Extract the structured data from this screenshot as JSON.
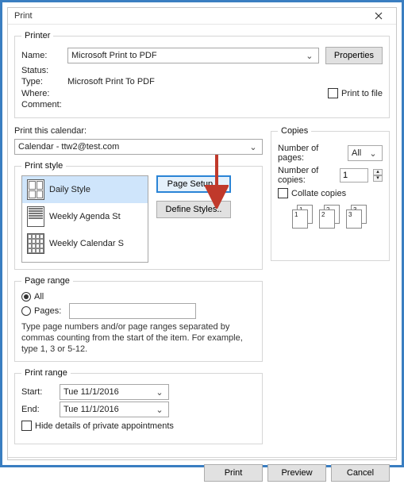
{
  "window": {
    "title": "Print"
  },
  "printer": {
    "group_label": "Printer",
    "name_label": "Name:",
    "name_value": "Microsoft Print to PDF",
    "properties_btn": "Properties",
    "status_label": "Status:",
    "status_value": "",
    "type_label": "Type:",
    "type_value": "Microsoft Print To PDF",
    "where_label": "Where:",
    "where_value": "",
    "comment_label": "Comment:",
    "comment_value": "",
    "print_to_file_label": "Print to file"
  },
  "calendar": {
    "label": "Print this calendar:",
    "value": "Calendar - ttw2@test.com"
  },
  "style": {
    "group_label": "Print style",
    "items": [
      {
        "label": "Daily Style",
        "selected": true
      },
      {
        "label": "Weekly Agenda St",
        "selected": false
      },
      {
        "label": "Weekly Calendar S",
        "selected": false
      }
    ],
    "page_setup_btn": "Page Setup...",
    "define_styles_btn": "Define Styles.."
  },
  "page_range": {
    "group_label": "Page range",
    "all_label": "All",
    "pages_label": "Pages:",
    "pages_value": "",
    "hint": "Type page numbers and/or page ranges separated by commas counting from the start of the item.  For example, type 1, 3 or 5-12."
  },
  "print_range": {
    "group_label": "Print range",
    "start_label": "Start:",
    "end_label": "End:",
    "start_value": "Tue 11/1/2016",
    "end_value": "Tue 11/1/2016",
    "hide_details_label": "Hide details of private appointments"
  },
  "copies": {
    "group_label": "Copies",
    "num_pages_label": "Number of pages:",
    "num_pages_value": "All",
    "num_copies_label": "Number of copies:",
    "num_copies_value": "1",
    "collate_label": "Collate copies",
    "graphic_nums": [
      "1",
      "1",
      "2",
      "2",
      "3",
      "3"
    ]
  },
  "footer": {
    "print": "Print",
    "preview": "Preview",
    "cancel": "Cancel"
  }
}
